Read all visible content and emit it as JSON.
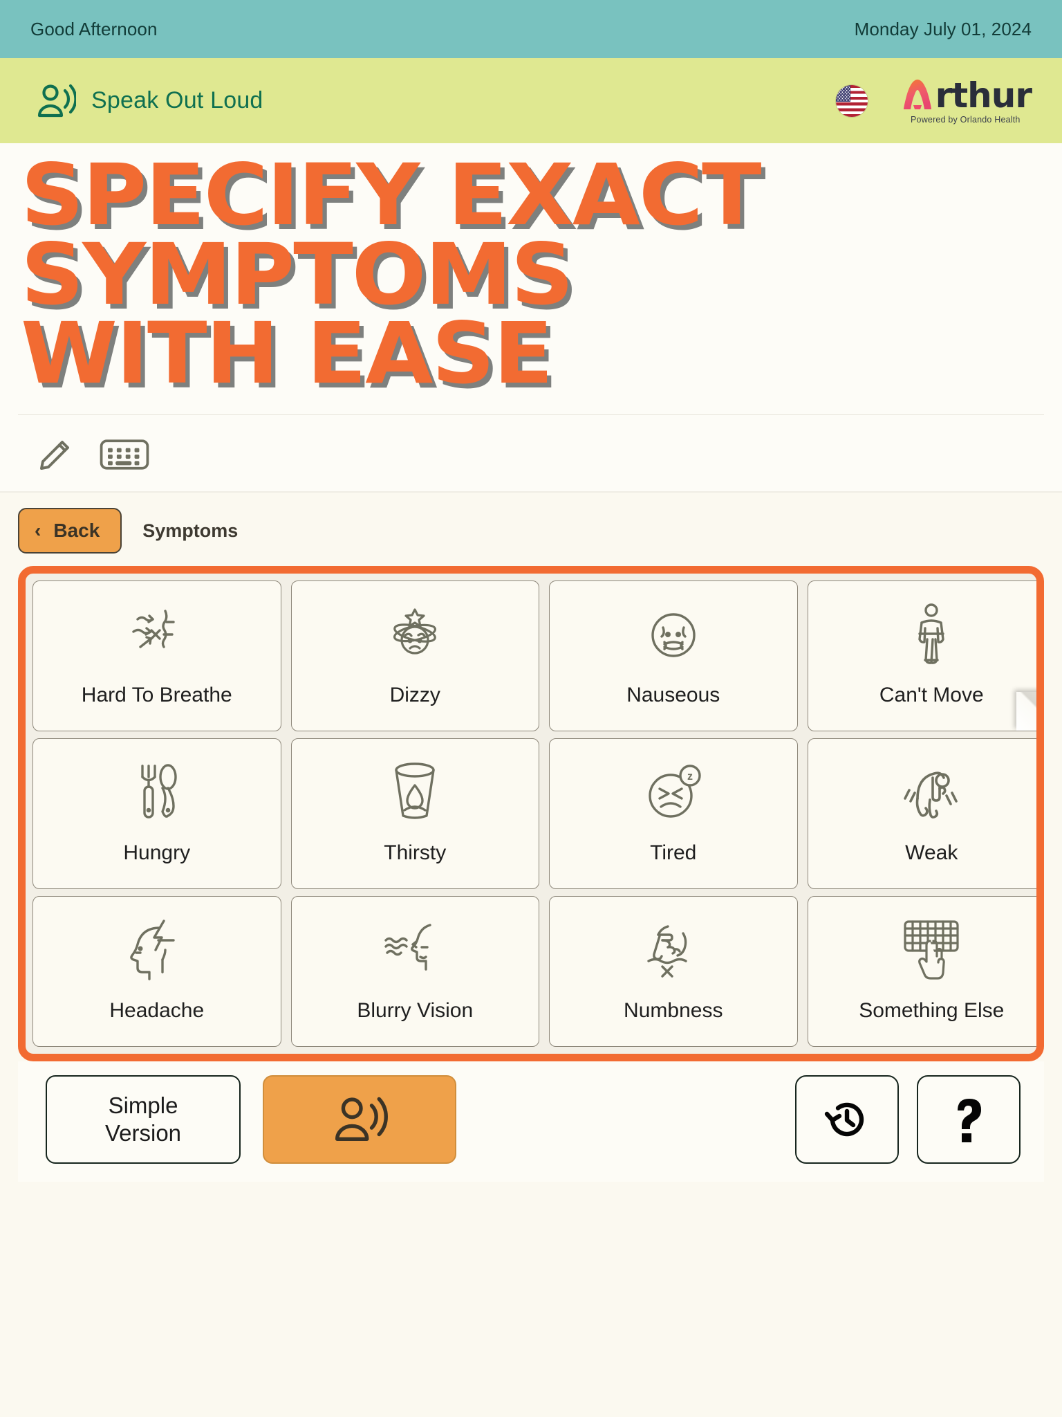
{
  "top_bar": {
    "greeting": "Good Afternoon",
    "date": "Monday July 01, 2024"
  },
  "speak_bar": {
    "label": "Speak Out Loud",
    "speaker_icon": "person-speaking-icon",
    "flag_icon": "us-flag-icon",
    "logo": {
      "word": "rthur",
      "full_name": "Arthur",
      "tagline": "Powered by Orlando Health"
    }
  },
  "headline": "Specify Exact\nSymptoms\nWith Ease",
  "tools": [
    {
      "icon": "pencil-icon",
      "name": "draw-tool"
    },
    {
      "icon": "keyboard-icon",
      "name": "keyboard-tool"
    }
  ],
  "navigation": {
    "back_label": "Back",
    "back_chevron": "chevron-left-icon",
    "breadcrumb": "Symptoms"
  },
  "grid": {
    "accent_color": "#f26b32",
    "cards": [
      {
        "label": "Hard To Breathe",
        "icon": "breathing-difficulty-icon"
      },
      {
        "label": "Dizzy",
        "icon": "dizzy-face-icon"
      },
      {
        "label": "Nauseous",
        "icon": "nauseated-face-icon"
      },
      {
        "label": "Can't Move",
        "icon": "immobile-person-icon"
      },
      {
        "label": "Hungry",
        "icon": "fork-spoon-icon"
      },
      {
        "label": "Thirsty",
        "icon": "water-glass-icon"
      },
      {
        "label": "Tired",
        "icon": "sleepy-face-icon"
      },
      {
        "label": "Weak",
        "icon": "hunched-person-icon"
      },
      {
        "label": "Headache",
        "icon": "head-lightning-icon"
      },
      {
        "label": "Blurry Vision",
        "icon": "blurry-vision-face-icon"
      },
      {
        "label": "Numbness",
        "icon": "numb-hand-icon"
      },
      {
        "label": "Something Else",
        "icon": "keyboard-finger-icon"
      }
    ]
  },
  "bottom_bar": {
    "simple_version_line1": "Simple",
    "simple_version_line2": "Version",
    "speak_icon": "person-speaking-icon",
    "history_icon": "history-clock-icon",
    "help_icon": "question-mark-icon"
  },
  "colors": {
    "greeting_bar": "#79c2bf",
    "speak_bar": "#dfe891",
    "headline": "#f26b32",
    "accent_orange": "#efa14a",
    "grid_border": "#f26b32",
    "speak_label": "#0f7050"
  }
}
